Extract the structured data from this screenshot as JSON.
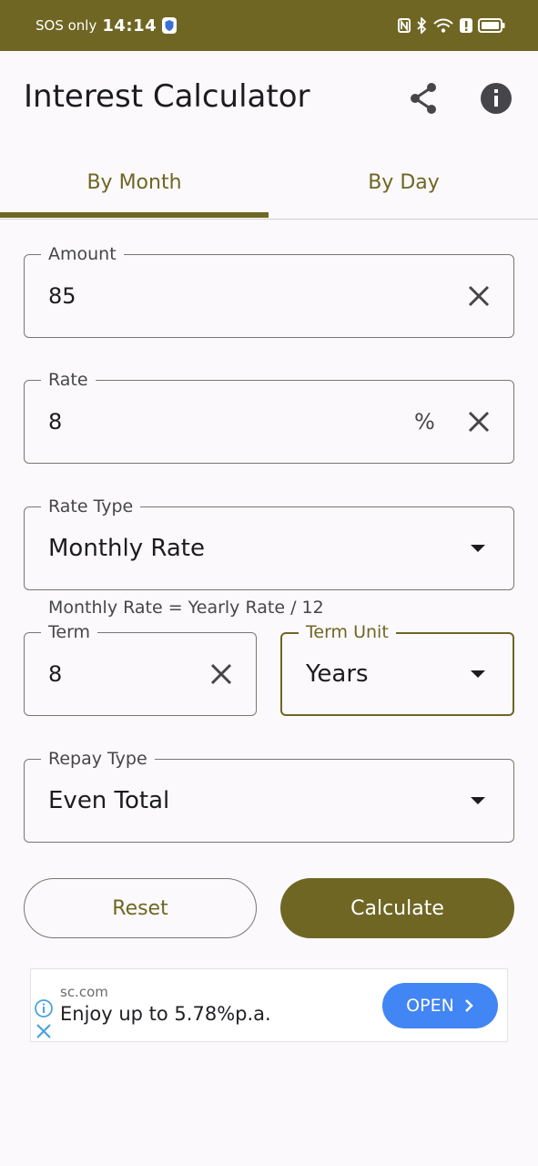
{
  "status_bar": {
    "carrier": "SOS only",
    "time": "14:14"
  },
  "app_bar": {
    "title": "Interest Calculator",
    "share_icon": "share-icon",
    "info_icon": "info-icon"
  },
  "tabs": [
    {
      "label": "By Month",
      "selected": true
    },
    {
      "label": "By Day",
      "selected": false
    }
  ],
  "form": {
    "amount": {
      "label": "Amount",
      "value": "85"
    },
    "rate": {
      "label": "Rate",
      "value": "8",
      "suffix": "%"
    },
    "rate_type": {
      "label": "Rate Type",
      "value": "Monthly Rate",
      "helper": "Monthly Rate = Yearly Rate / 12"
    },
    "term": {
      "label": "Term",
      "value": "8"
    },
    "term_unit": {
      "label": "Term Unit",
      "value": "Years"
    },
    "repay_type": {
      "label": "Repay Type",
      "value": "Even Total"
    }
  },
  "buttons": {
    "reset": "Reset",
    "calculate": "Calculate"
  },
  "ad": {
    "domain": "sc.com",
    "text": "Enjoy up to 5.78%p.a.",
    "cta": "OPEN"
  },
  "colors": {
    "primary": "#6f6624",
    "background": "#fbf9fb",
    "ad_button": "#4285f4"
  }
}
